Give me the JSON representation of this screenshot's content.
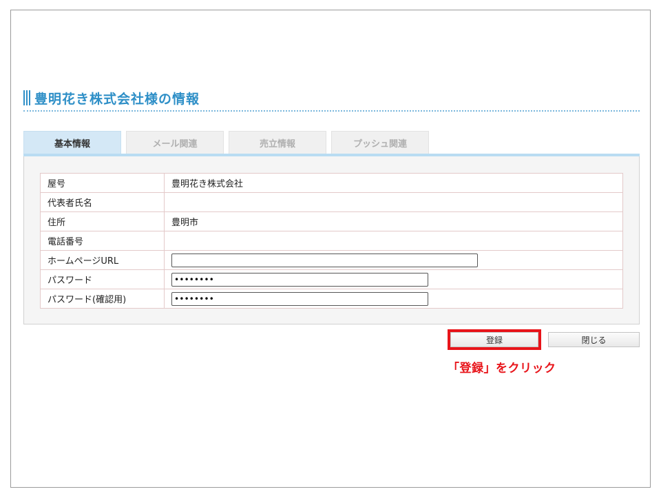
{
  "page": {
    "title": "豊明花き株式会社様の情報"
  },
  "tabs": [
    {
      "label": "基本情報",
      "active": true
    },
    {
      "label": "メール関連",
      "active": false
    },
    {
      "label": "売立情報",
      "active": false
    },
    {
      "label": "プッシュ関連",
      "active": false
    }
  ],
  "info": {
    "rows": [
      {
        "label": "屋号",
        "value": "豊明花き株式会社"
      },
      {
        "label": "代表者氏名",
        "value": ""
      },
      {
        "label": "住所",
        "value": "豊明市"
      },
      {
        "label": "電話番号",
        "value": ""
      },
      {
        "label": "ホームページURL",
        "value": ""
      },
      {
        "label": "パスワード",
        "value": "••••••••"
      },
      {
        "label": "パスワード(確認用)",
        "value": "••••••••"
      }
    ]
  },
  "buttons": {
    "register": "登録",
    "close": "閉じる"
  },
  "annotation": {
    "text": "「登録」をクリック",
    "color": "#e8141a"
  },
  "colors": {
    "accent": "#2e8fc7",
    "active_tab": "#d4e8f6",
    "highlight": "#e8141a"
  }
}
